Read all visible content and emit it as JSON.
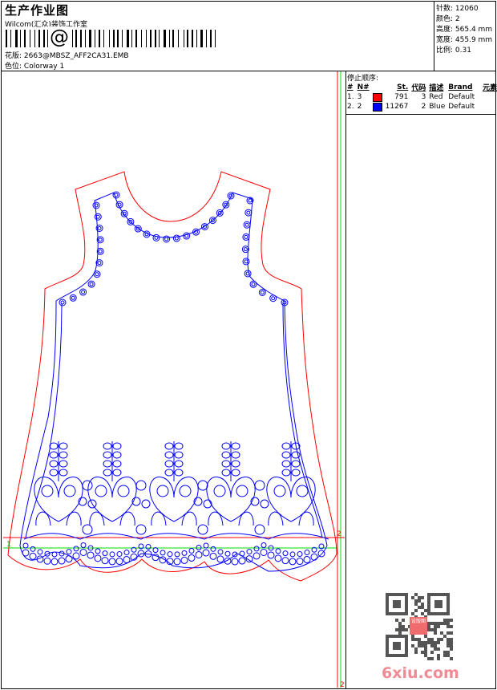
{
  "header": {
    "title": "生产作业图",
    "company": "Wilcom(汇众)装饰工作室",
    "barcode_symbol": "@",
    "design_label": "花版:",
    "design_value": "2663@MBSZ_AFF2CA31.EMB",
    "colorway_label": "色位:",
    "colorway_value": "Colorway 1"
  },
  "info": {
    "stitches_label": "针数:",
    "stitches": "12060",
    "colors_label": "颜色:",
    "colors": "2",
    "height_label": "高度:",
    "height": "565.4 mm",
    "width_label": "宽度:",
    "width": "455.9 mm",
    "scale_label": "比例:",
    "scale": "0.31"
  },
  "stop_sequence": {
    "title": "停止顺序:",
    "columns": [
      "#",
      "N#",
      "St.",
      "代码",
      "描述",
      "Brand",
      "元素"
    ],
    "rows": [
      {
        "idx": "1.",
        "n": "3",
        "color": "#ff0000",
        "st": "791",
        "code": "3",
        "desc": "Red",
        "brand": "Default"
      },
      {
        "idx": "2.",
        "n": "2",
        "color": "#0000ff",
        "st": "11267",
        "code": "2",
        "desc": "Blue",
        "brand": "Default"
      }
    ]
  },
  "canvas": {
    "marker_start": "1",
    "marker_end_top": "2",
    "marker_end_bottom": "2",
    "outline_color": "#ff0000",
    "stitch_color": "#0000ff",
    "guide_color": "#00dd00"
  },
  "watermark": {
    "text": "6xiu.com",
    "seal": "设版图"
  }
}
